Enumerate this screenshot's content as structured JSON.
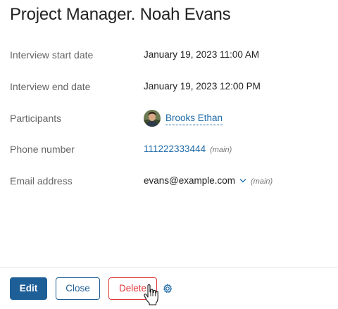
{
  "header": {
    "title": "Project Manager. Noah Evans"
  },
  "fields": {
    "start": {
      "label": "Interview start date",
      "value": "January 19, 2023 11:00 AM"
    },
    "end": {
      "label": "Interview end date",
      "value": "January 19, 2023 12:00 PM"
    },
    "participants": {
      "label": "Participants",
      "name": "Brooks Ethan",
      "avatar_icon": "user-avatar"
    },
    "phone": {
      "label": "Phone number",
      "value": "111222333444",
      "tag": "(main)"
    },
    "email": {
      "label": "Email address",
      "value": "evans@example.com",
      "tag": "(main)",
      "icon": "chevron-down-icon"
    }
  },
  "footer": {
    "edit_label": "Edit",
    "close_label": "Close",
    "delete_label": "Delete",
    "settings_icon": "gear-icon"
  },
  "colors": {
    "accent": "#1f5f97",
    "link": "#1e6aa8",
    "danger": "#e0383b"
  }
}
